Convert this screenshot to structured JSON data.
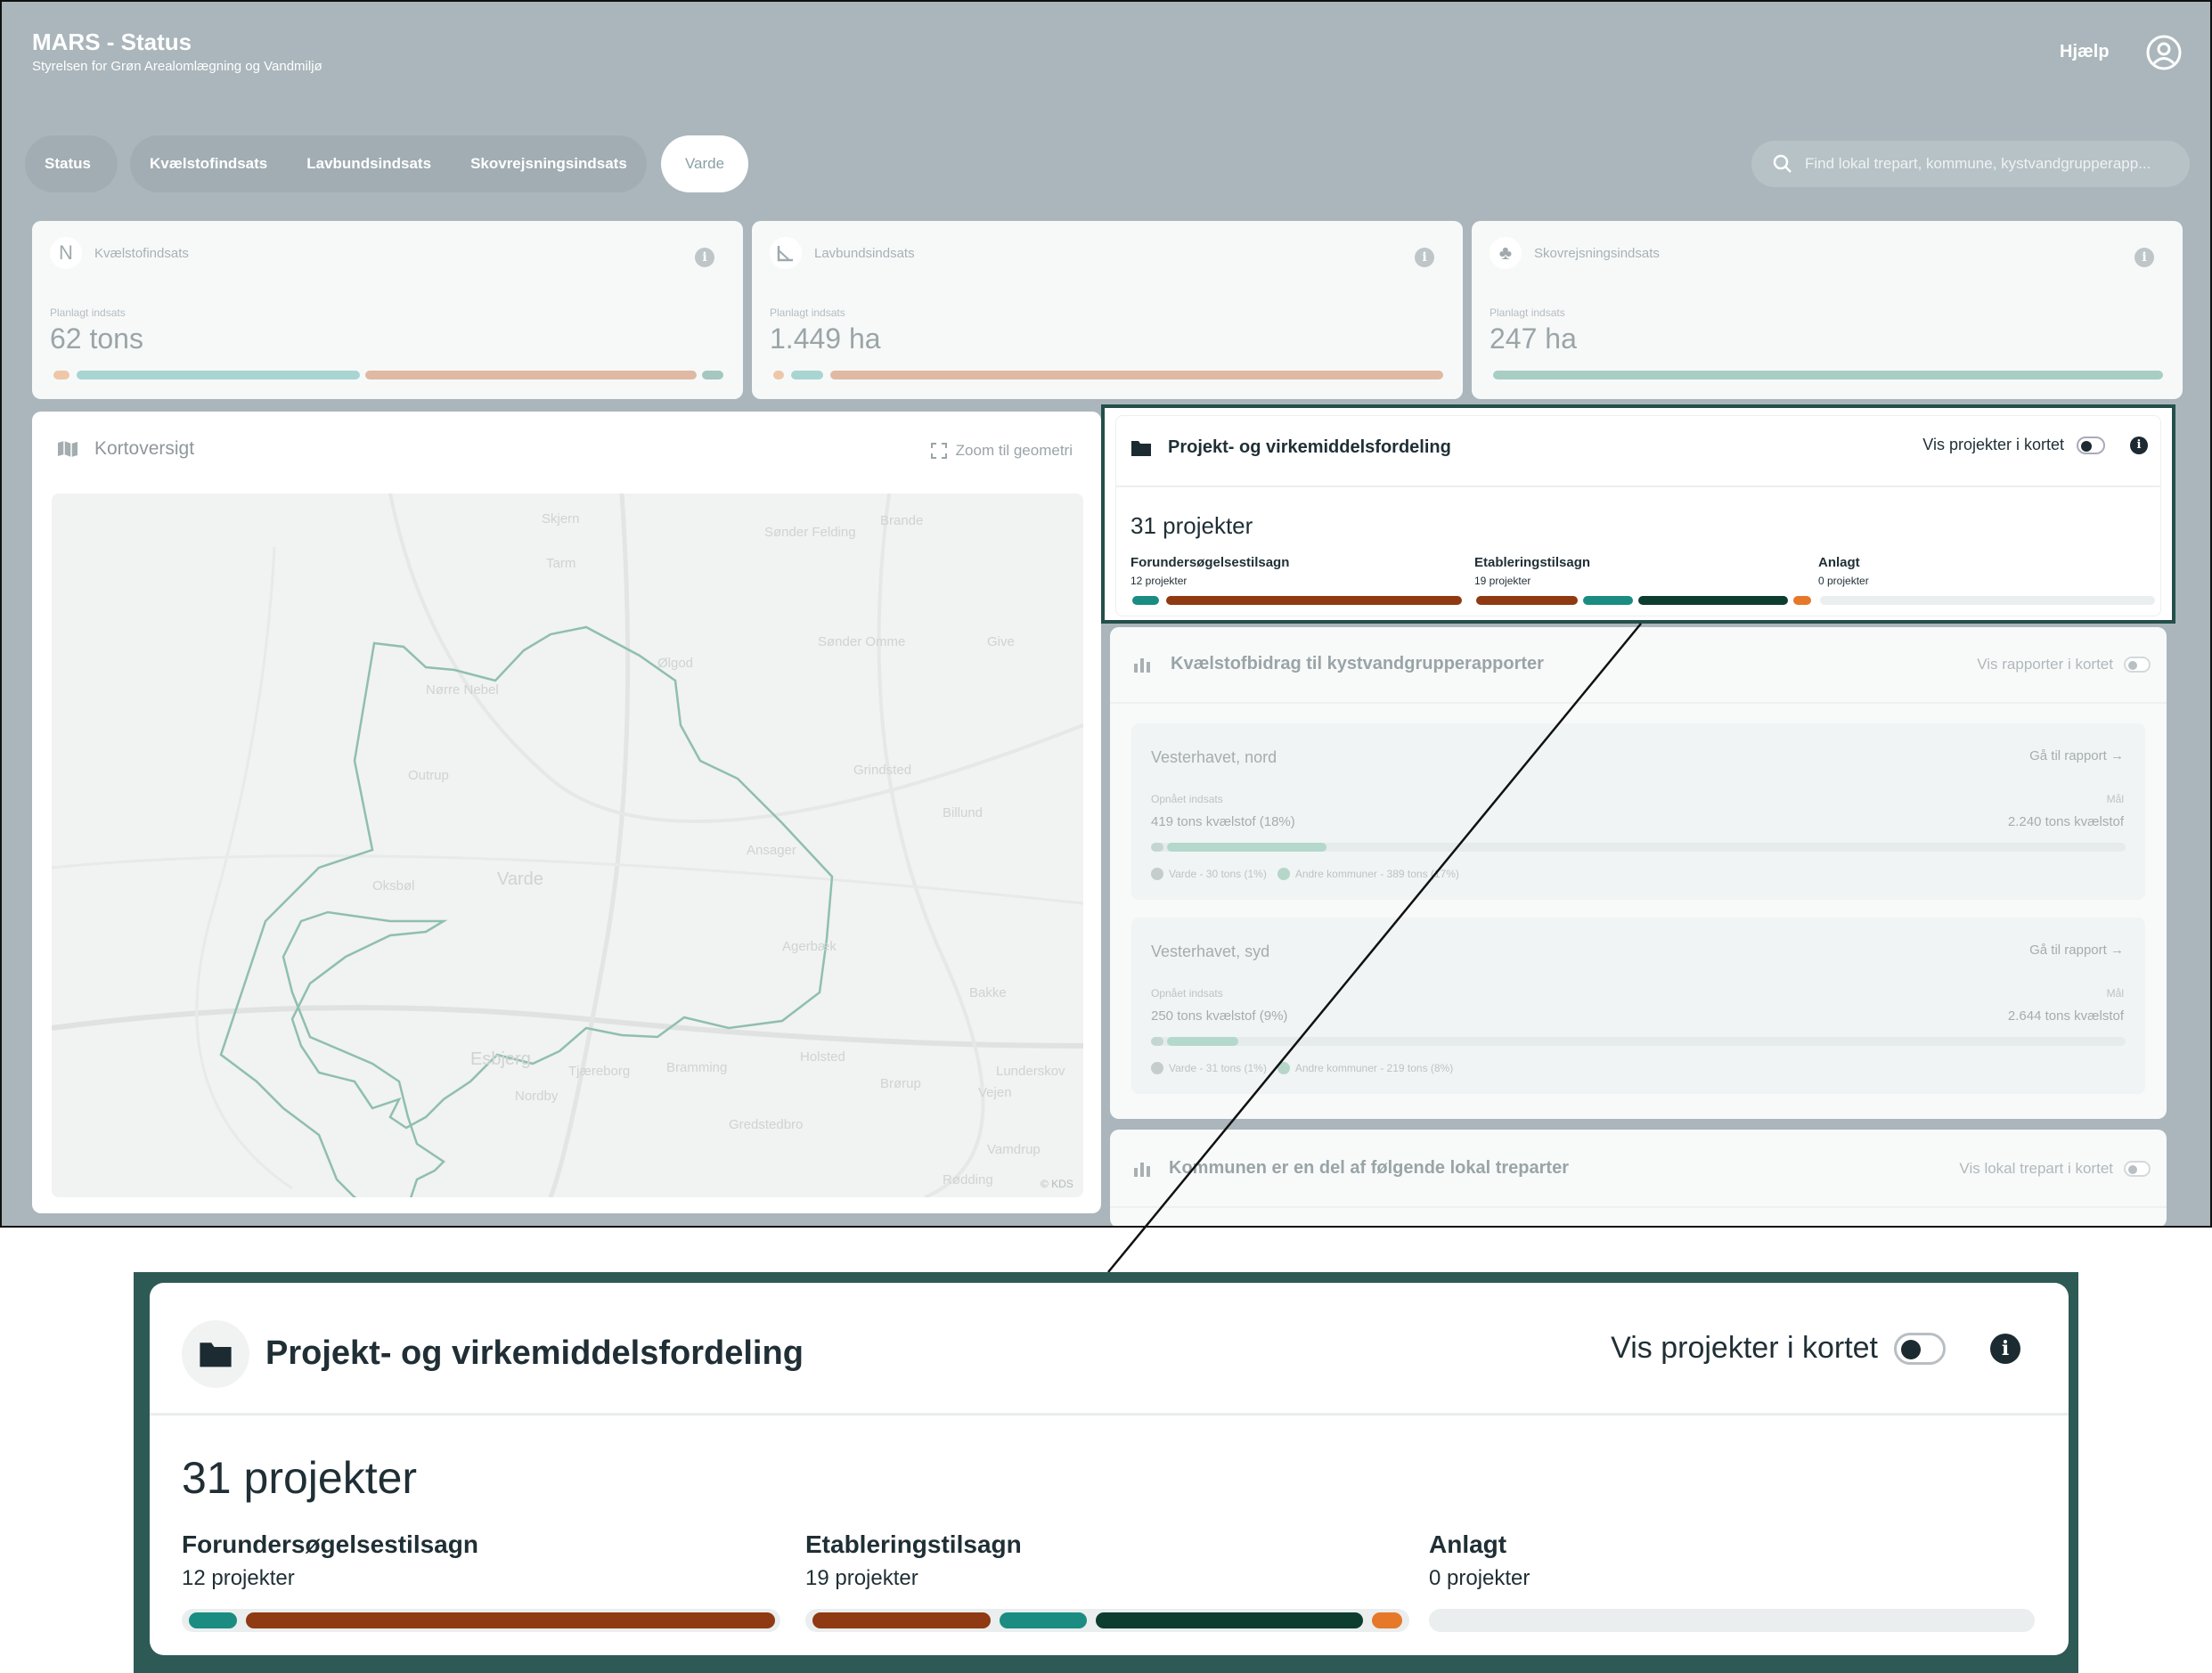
{
  "app": {
    "title": "MARS - Status",
    "subtitle": "Styrelsen for Grøn Arealomlægning og Vandmiljø",
    "help": "Hjælp"
  },
  "nav": {
    "tabs": [
      "Status",
      "Kvælstofindsats",
      "Lavbundsindsats",
      "Skovrejsningsindsats",
      "Varde"
    ],
    "active": "Varde"
  },
  "search": {
    "placeholder": "Find lokal trepart, kommune, kystvandgrupperapp..."
  },
  "kpis": [
    {
      "icon": "N",
      "title": "Kvælstofindsats",
      "label": "Planlagt indsats",
      "value": "62 tons"
    },
    {
      "title": "Lavbundsindsats",
      "label": "Planlagt indsats",
      "value": "1.449 ha"
    },
    {
      "title": "Skovrejsningsindsats",
      "label": "Planlagt indsats",
      "value": "247 ha"
    }
  ],
  "map": {
    "title": "Kortoversigt",
    "zoom": "Zoom til geometri",
    "copyright": "© KDS",
    "towns": [
      "Skjern",
      "Tarm",
      "Brande",
      "Sønder Felding",
      "Nørre Nebel",
      "Sønder Omme",
      "Give",
      "Outrup",
      "Ølgod",
      "Grindsted",
      "Billund",
      "Oksbøl",
      "Varde",
      "Ansager",
      "Esbjerg",
      "Tjæreborg",
      "Bramming",
      "Holsted",
      "Brørup",
      "Vejen",
      "Vamdrup",
      "Lunderskov",
      "Gredstedbro",
      "Nordby",
      "Rødding",
      "Bakke",
      "Agerbæk"
    ]
  },
  "projects": {
    "title": "Projekt- og virkemiddelsfordeling",
    "toggle": "Vis projekter i kortet",
    "count": "31 projekter",
    "phases": [
      {
        "name": "Forundersøgelsestilsagn",
        "count": "12 projekter"
      },
      {
        "name": "Etableringstilsagn",
        "count": "19 projekter"
      },
      {
        "name": "Anlagt",
        "count": "0 projekter"
      }
    ]
  },
  "nitrogen": {
    "title": "Kvælstofbidrag til kystvandgrupperapporter",
    "toggle": "Vis rapporter i kortet",
    "reports": [
      {
        "name": "Vesterhavet, nord",
        "link": "Gå til rapport",
        "achieved_label": "Opnået indsats",
        "achieved": "419 tons kvælstof (18%)",
        "goal_label": "Mål",
        "goal": "2.240 tons kvælstof",
        "legend": [
          "Varde - 30 tons (1%)",
          "Andre kommuner - 389 tons (17%)"
        ],
        "pct": 18
      },
      {
        "name": "Vesterhavet, syd",
        "link": "Gå til rapport",
        "achieved_label": "Opnået indsats",
        "achieved": "250 tons kvælstof (9%)",
        "goal_label": "Mål",
        "goal": "2.644 tons kvælstof",
        "legend": [
          "Varde - 31 tons (1%)",
          "Andre kommuner - 219 tons (8%)"
        ],
        "pct": 9
      }
    ]
  },
  "local": {
    "title": "Kommunen er en del af følgende lokal treparter",
    "toggle": "Vis lokal trepart i kortet"
  },
  "colors": {
    "header": "#aab6bb",
    "teal": "#1b8c82",
    "rust": "#8f3a12",
    "darkgreen": "#0d3d2f",
    "orange": "#e6782a",
    "frame": "#244f4a"
  }
}
